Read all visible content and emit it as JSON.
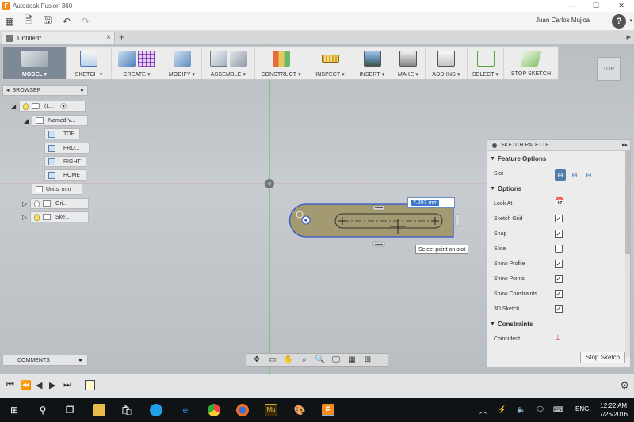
{
  "window": {
    "title": "Autodesk Fusion 360",
    "controls": [
      "—",
      "☐",
      "✕"
    ]
  },
  "quick_access": {
    "user_name": "Juan Carlos Mujica",
    "help": "?"
  },
  "document_tab": {
    "title": "Untitled*",
    "close": "×"
  },
  "toolbar": {
    "workspace": "MODEL ▾",
    "groups": [
      {
        "label": "SKETCH ▾"
      },
      {
        "label": "CREATE ▾"
      },
      {
        "label": "MODIFY ▾"
      },
      {
        "label": "ASSEMBLE ▾"
      },
      {
        "label": "CONSTRUCT ▾"
      },
      {
        "label": "INSPECT ▾"
      },
      {
        "label": "INSERT ▾"
      },
      {
        "label": "MAKE ▾"
      },
      {
        "label": "ADD-INS ▾"
      },
      {
        "label": "SELECT ▾"
      },
      {
        "label": "STOP SKETCH"
      }
    ]
  },
  "view_cube": {
    "label": "TOP"
  },
  "browser": {
    "title": "BROWSER",
    "root": "(L...",
    "named_views": "Named V...",
    "views": [
      "TOP",
      "FRO...",
      "RIGHT",
      "HOME"
    ],
    "units": "Units: mm",
    "origin": "Ori...",
    "sketches": "Ske..."
  },
  "canvas": {
    "dimension_value": "7.207 mm",
    "tooltip": "Select point on slot",
    "colors": {
      "slot_fill": "#a39a72",
      "slot_stroke": "#2f55c8",
      "axis_green": "#4fbf4a",
      "axis_red": "#d46a6a"
    }
  },
  "sketch_palette": {
    "title": "SKETCH PALETTE",
    "feature_options_header": "Feature Options",
    "slot_label": "Slot",
    "options_header": "Options",
    "options": [
      {
        "label": "Look At",
        "control": "icon"
      },
      {
        "label": "Sketch Grid",
        "checked": true
      },
      {
        "label": "Snap",
        "checked": true
      },
      {
        "label": "Slice",
        "checked": false
      },
      {
        "label": "Show Profile",
        "checked": true
      },
      {
        "label": "Show Points",
        "checked": true
      },
      {
        "label": "Show Constraints",
        "checked": true
      },
      {
        "label": "3D Sketch",
        "checked": true
      }
    ],
    "constraints_header": "Constraints",
    "constraint_first": "Coincident",
    "stop_button": "Stop Sketch"
  },
  "comments": {
    "label": "COMMENTS"
  },
  "taskbar": {
    "language": "ENG",
    "time": "12:22 AM",
    "date": "7/26/2016"
  }
}
